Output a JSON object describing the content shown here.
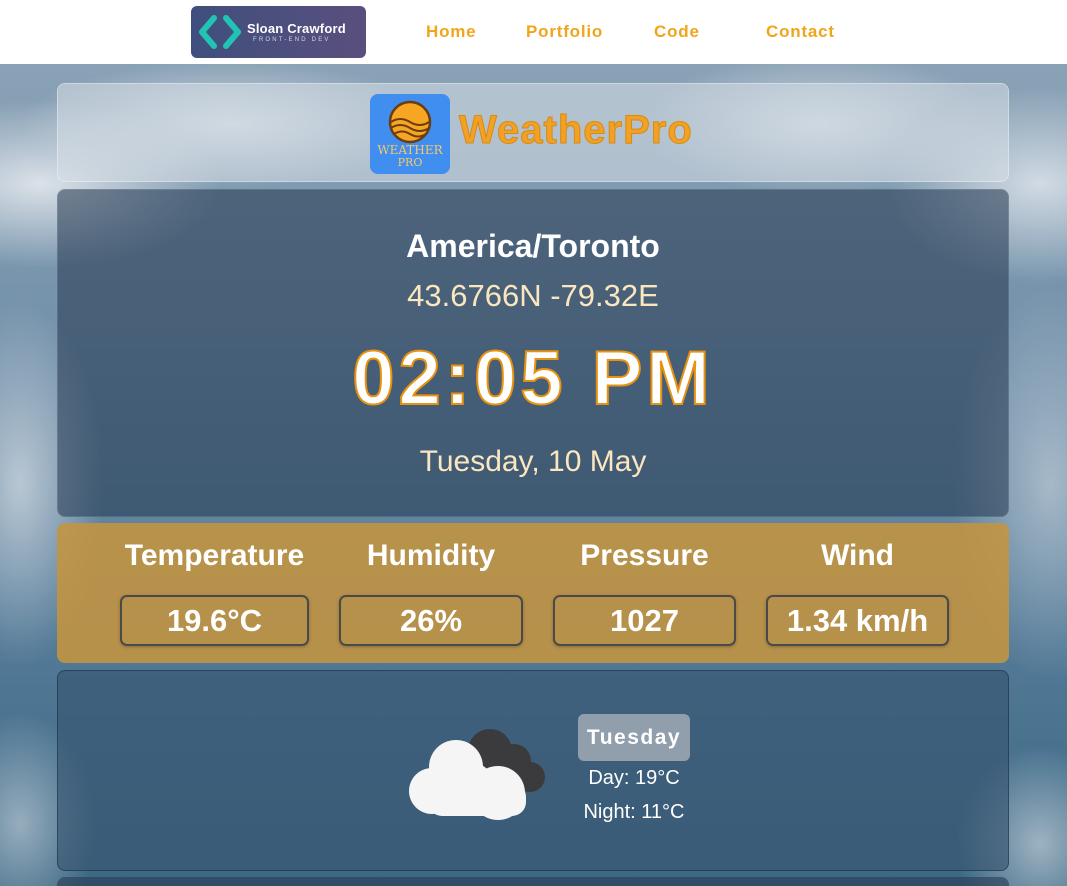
{
  "nav": {
    "logo": {
      "name": "Sloan Crawford",
      "subtitle": "FRONT-END DEV"
    },
    "links": [
      "Home",
      "Portfolio",
      "Code",
      "Contact"
    ]
  },
  "header": {
    "app_icon_text": [
      "WEATHER",
      "PRO"
    ],
    "app_title": "WeatherPro"
  },
  "location": {
    "timezone": "America/Toronto",
    "coordinates": "43.6766N -79.32E",
    "time": "02:05 PM",
    "date": "Tuesday, 10 May"
  },
  "stats": [
    {
      "label": "Temperature",
      "value": "19.6°C"
    },
    {
      "label": "Humidity",
      "value": "26%"
    },
    {
      "label": "Pressure",
      "value": "1027"
    },
    {
      "label": "Wind",
      "value": "1.34 km/h"
    }
  ],
  "forecast": {
    "icon": "cloudy-icon",
    "day": "Tuesday",
    "day_temp": "Day: 19°C",
    "night_temp": "Night: 11°C"
  },
  "colors": {
    "accent": "#f0a51c",
    "stats_panel": "#c49440",
    "app_icon_bg": "#3f8ef0"
  }
}
